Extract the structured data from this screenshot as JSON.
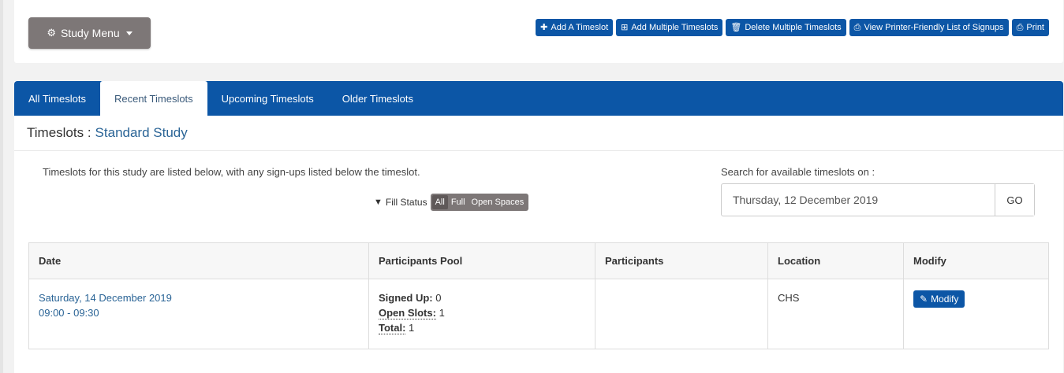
{
  "header": {
    "study_menu_label": "Study Menu",
    "actions": [
      {
        "icon": "plus-icon",
        "glyph": "✚",
        "label": "Add A Timeslot"
      },
      {
        "icon": "plus-square-icon",
        "glyph": "⊞",
        "label": "Add Multiple Timeslots"
      },
      {
        "icon": "trash-icon",
        "glyph": "🗑",
        "label": "Delete Multiple Timeslots"
      },
      {
        "icon": "printer-icon",
        "glyph": "⎙",
        "label": "View Printer-Friendly List of Signups"
      },
      {
        "icon": "printer-icon",
        "glyph": "⎙",
        "label": "Print"
      }
    ]
  },
  "tabs": [
    {
      "label": "All Timeslots",
      "active": false
    },
    {
      "label": "Recent Timeslots",
      "active": true
    },
    {
      "label": "Upcoming Timeslots",
      "active": false
    },
    {
      "label": "Older Timeslots",
      "active": false
    }
  ],
  "page": {
    "title_prefix": "Timeslots :",
    "title_link": "Standard Study",
    "intro": "Timeslots for this study are listed below, with any sign-ups listed below the timeslot."
  },
  "filter": {
    "label": "Fill Status",
    "options": [
      "All",
      "Full",
      "Open Spaces"
    ],
    "selected": "All"
  },
  "search": {
    "label": "Search for available timeslots on :",
    "value": "Thursday, 12 December 2019",
    "go_label": "GO"
  },
  "table": {
    "headers": [
      "Date",
      "Participants Pool",
      "Participants",
      "Location",
      "Modify"
    ],
    "rows": [
      {
        "date": "Saturday, 14 December 2019",
        "time": "09:00 - 09:30",
        "signed_up_label": "Signed Up:",
        "signed_up": "0",
        "open_slots_label": "Open Slots:",
        "open_slots": "1",
        "total_label": "Total:",
        "total": "1",
        "participants": "",
        "location": "CHS",
        "modify_label": "Modify"
      }
    ]
  },
  "colors": {
    "primary": "#0c56a6",
    "menu_gray": "#7d7777",
    "link": "#2a6496"
  }
}
